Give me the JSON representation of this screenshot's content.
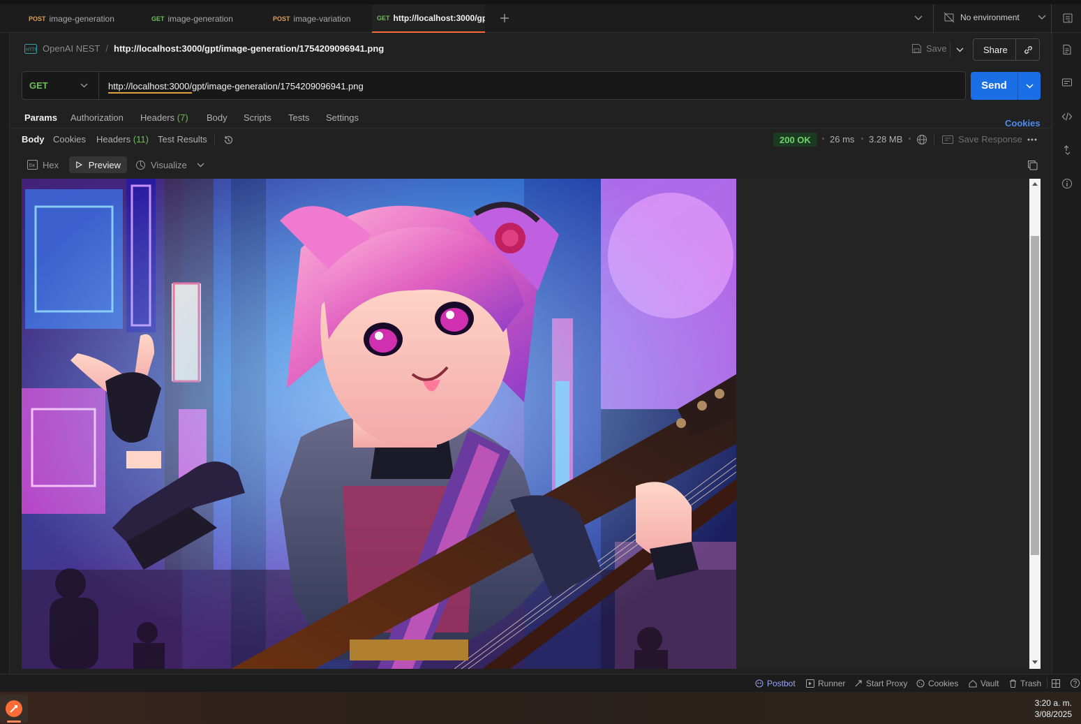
{
  "tabs": [
    {
      "method": "POST",
      "label": "image-generation",
      "active": false
    },
    {
      "method": "GET",
      "label": "image-generation",
      "active": false
    },
    {
      "method": "POST",
      "label": "image-variation",
      "active": false
    },
    {
      "method": "GET",
      "label": "http://localhost:3000/gp",
      "active": true
    }
  ],
  "environment": {
    "label": "No environment"
  },
  "breadcrumb": {
    "collection": "OpenAI NEST",
    "separator": "/",
    "request": "http://localhost:3000/gpt/image-generation/1754209096941.png"
  },
  "header_actions": {
    "save": "Save",
    "share": "Share"
  },
  "request": {
    "method": "GET",
    "url": "http://localhost:3000/gpt/image-generation/1754209096941.png",
    "send": "Send"
  },
  "request_tabs": [
    {
      "label": "Params",
      "active": true
    },
    {
      "label": "Authorization"
    },
    {
      "label": "Headers",
      "count": "(7)"
    },
    {
      "label": "Body"
    },
    {
      "label": "Scripts"
    },
    {
      "label": "Tests"
    },
    {
      "label": "Settings"
    }
  ],
  "cookies_link": "Cookies",
  "response_tabs": [
    {
      "label": "Body",
      "active": true
    },
    {
      "label": "Cookies"
    },
    {
      "label": "Headers",
      "count": "(11)"
    },
    {
      "label": "Test Results"
    }
  ],
  "response_meta": {
    "status": "200 OK",
    "time": "26 ms",
    "size": "3.28 MB",
    "save_response": "Save Response"
  },
  "view_modes": {
    "hex": "Hex",
    "preview": "Preview",
    "visualize": "Visualize"
  },
  "statusbar": {
    "postbot": "Postbot",
    "runner": "Runner",
    "start_proxy": "Start Proxy",
    "cookies": "Cookies",
    "vault": "Vault",
    "trash": "Trash"
  },
  "clock": {
    "time": "3:20 a. m.",
    "date": "3/08/2025"
  },
  "colors": {
    "accent": "#ff6c37",
    "send": "#1a6ee6",
    "get": "#6bbf59",
    "post": "#d8a25c",
    "status_ok": "#6fd46a"
  }
}
